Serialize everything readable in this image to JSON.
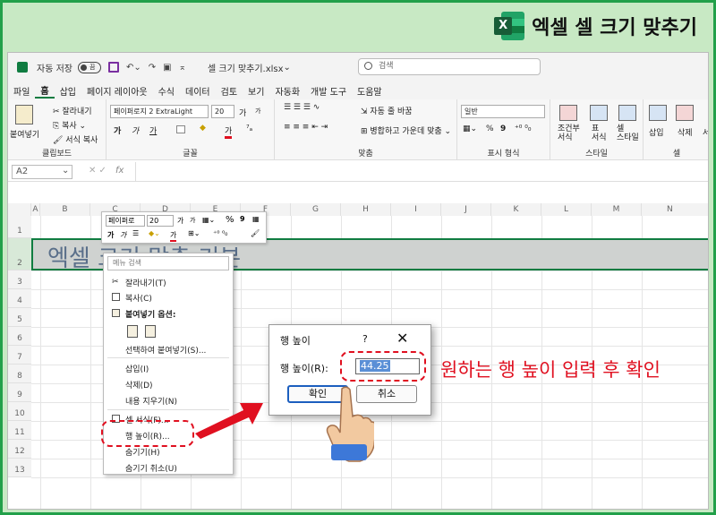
{
  "banner": {
    "logo_letter": "X",
    "title": "엑셀 셀 크기 맞추기",
    "accent": "#22a04a"
  },
  "qat": {
    "autosave_label": "자동 저장",
    "toggle_state": "끔",
    "filename": "셀 크기 맞추기.xlsx",
    "search_placeholder": "검색"
  },
  "menu": {
    "items": [
      "파일",
      "홈",
      "삽입",
      "페이지 레이아웃",
      "수식",
      "데이터",
      "검토",
      "보기",
      "자동화",
      "개발 도구",
      "도움말"
    ],
    "active": "홈"
  },
  "ribbon": {
    "clipboard": {
      "paste": "붙여넣기",
      "cut": "잘라내기",
      "copy": "복사",
      "format_painter": "서식 복사",
      "label": "클립보드"
    },
    "font": {
      "name": "페이퍼로지 2 ExtraLight",
      "size": "20",
      "grow": "가",
      "shrink": "가",
      "bold": "가",
      "italic": "가",
      "underline": "가",
      "fontcolor": "가",
      "label": "글꼴"
    },
    "align": {
      "wrap": "자동 줄 바꿈",
      "merge": "병합하고 가운데 맞춤",
      "label": "맞춤"
    },
    "number": {
      "format": "일반",
      "percent": "%",
      "comma": "9",
      "label": "표시 형식"
    },
    "styles": {
      "conditional": "조건부\n서식",
      "table": "표\n서식",
      "cell": "셀\n스타일",
      "label": "스타일"
    },
    "cells": {
      "insert": "삽입",
      "delete": "삭제",
      "format": "서",
      "label": "셀"
    }
  },
  "formula_bar": {
    "name_box": "A2",
    "fx": "fx"
  },
  "grid": {
    "columns": [
      "A",
      "B",
      "C",
      "D",
      "E",
      "F",
      "G",
      "H",
      "I",
      "J",
      "K",
      "L",
      "M",
      "N"
    ],
    "rows": [
      "1",
      "2",
      "3",
      "4",
      "5",
      "6",
      "7",
      "8",
      "9",
      "10",
      "11",
      "12",
      "13"
    ],
    "row2_text": "엑셀 크기 맞춤 기본"
  },
  "minibar": {
    "font": "페이퍼로",
    "size": "20",
    "grow": "가",
    "shrink": "가",
    "percent": "%",
    "comma": "9",
    "bold": "가",
    "italic": "가",
    "fontcolor": "가"
  },
  "context_menu": {
    "search": "메뉴 검색",
    "cut": "잘라내기(T)",
    "copy": "복사(C)",
    "paste_options": "붙여넣기 옵션:",
    "paste_special": "선택하여 붙여넣기(S)...",
    "insert": "삽입(I)",
    "delete": "삭제(D)",
    "clear": "내용 지우기(N)",
    "format_cells": "셀 서식(F)...",
    "row_height": "행 높이(R)...",
    "hide": "숨기기(H)",
    "unhide": "숨기기 취소(U)"
  },
  "dialog": {
    "title": "행 높이",
    "help": "?",
    "close": "✕",
    "label": "행 높이(R):",
    "value": "44.25",
    "ok": "확인",
    "cancel": "취소"
  },
  "annotation": {
    "text": "원하는 행 높이 입력 후 확인",
    "color": "#e01020"
  }
}
